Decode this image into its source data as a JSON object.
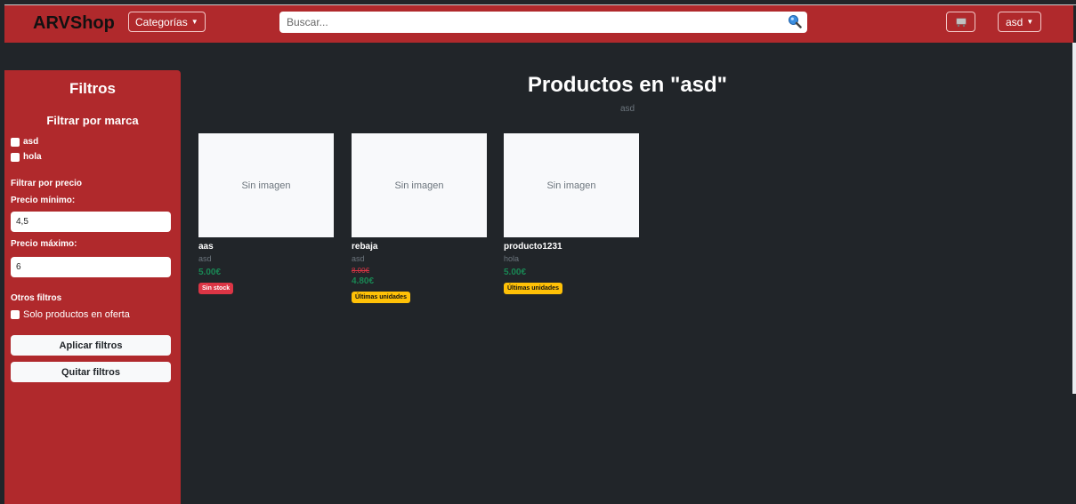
{
  "navbar": {
    "brand": "ARVShop",
    "categories_label": "Categorías",
    "search_placeholder": "Buscar...",
    "user_label": "asd"
  },
  "sidebar": {
    "title": "Filtros",
    "brand_filter_title": "Filtrar por marca",
    "brands": [
      "asd",
      "hola"
    ],
    "price_filter_title": "Filtrar por precio",
    "min_label": "Precio mínimo:",
    "min_value": "4,5",
    "max_label": "Precio máximo:",
    "max_value": "6",
    "other_filters_title": "Otros filtros",
    "offer_label": "Solo productos en oferta",
    "apply_label": "Aplicar filtros",
    "clear_label": "Quitar filtros"
  },
  "main": {
    "title": "Productos en \"asd\"",
    "subtitle": "asd",
    "products": [
      {
        "image_text": "Sin imagen",
        "name": "aas",
        "brand": "asd",
        "price": "5.00€",
        "badge": "Sin stock",
        "badge_color": "#dc3545"
      },
      {
        "image_text": "Sin imagen",
        "name": "rebaja",
        "brand": "asd",
        "old_price": "8.00€",
        "price": "4.80€",
        "badge": "Últimas unidades",
        "badge_color": "#ffc107"
      },
      {
        "image_text": "Sin imagen",
        "name": "producto1231",
        "brand": "hola",
        "price": "5.00€",
        "badge": "Últimas unidades",
        "badge_color": "#ffc107"
      }
    ]
  },
  "colors": {
    "primary": "#b0292c",
    "background": "#212529",
    "price_green": "#198754"
  }
}
